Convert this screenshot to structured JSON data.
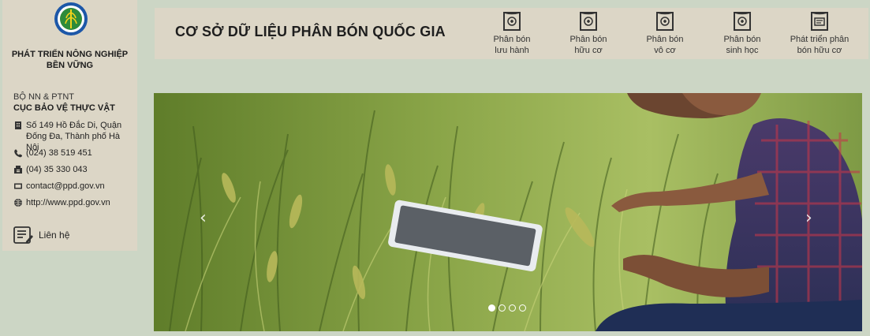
{
  "sidebar": {
    "org_name_line1": "PHÁT TRIỂN NÔNG NGHIỆP",
    "org_name_line2": "BỀN VỮNG",
    "ministry": "BỘ NN & PTNT",
    "department": "CỤC BẢO VỆ THỰC VẬT",
    "address_line1": "Số 149 Hồ Đắc Di, Quận",
    "address_line2": "Đống Đa, Thành phố Hà Nội",
    "phone": "(024) 38 519 451",
    "fax": "(04) 35 330 043",
    "email": "contact@ppd.gov.vn",
    "website": "http://www.ppd.gov.vn",
    "contact_label": "Liên hệ"
  },
  "header": {
    "title": "CƠ SỞ DỮ LIỆU PHÂN BÓN QUỐC GIA",
    "nav": [
      {
        "line1": "Phân bón",
        "line2": "lưu hành",
        "icon": "fertilizer-bag-icon"
      },
      {
        "line1": "Phân bón",
        "line2": "hữu cơ",
        "icon": "fertilizer-bag-icon"
      },
      {
        "line1": "Phân bón",
        "line2": "vô cơ",
        "icon": "fertilizer-bag-icon"
      },
      {
        "line1": "Phân bón",
        "line2": "sinh học",
        "icon": "fertilizer-bag-icon"
      },
      {
        "line1": "Phát triển phân",
        "line2": "bón hữu cơ",
        "icon": "fertilizer-bag-icon"
      }
    ]
  },
  "banner": {
    "slide_count": 4,
    "active_slide": 1,
    "prev_icon": "chevron-left-icon",
    "next_icon": "chevron-right-icon"
  },
  "colors": {
    "page_bg": "#ccd6c5",
    "panel_bg": "#dcd6c6",
    "text_dark": "#1e1e1e"
  }
}
